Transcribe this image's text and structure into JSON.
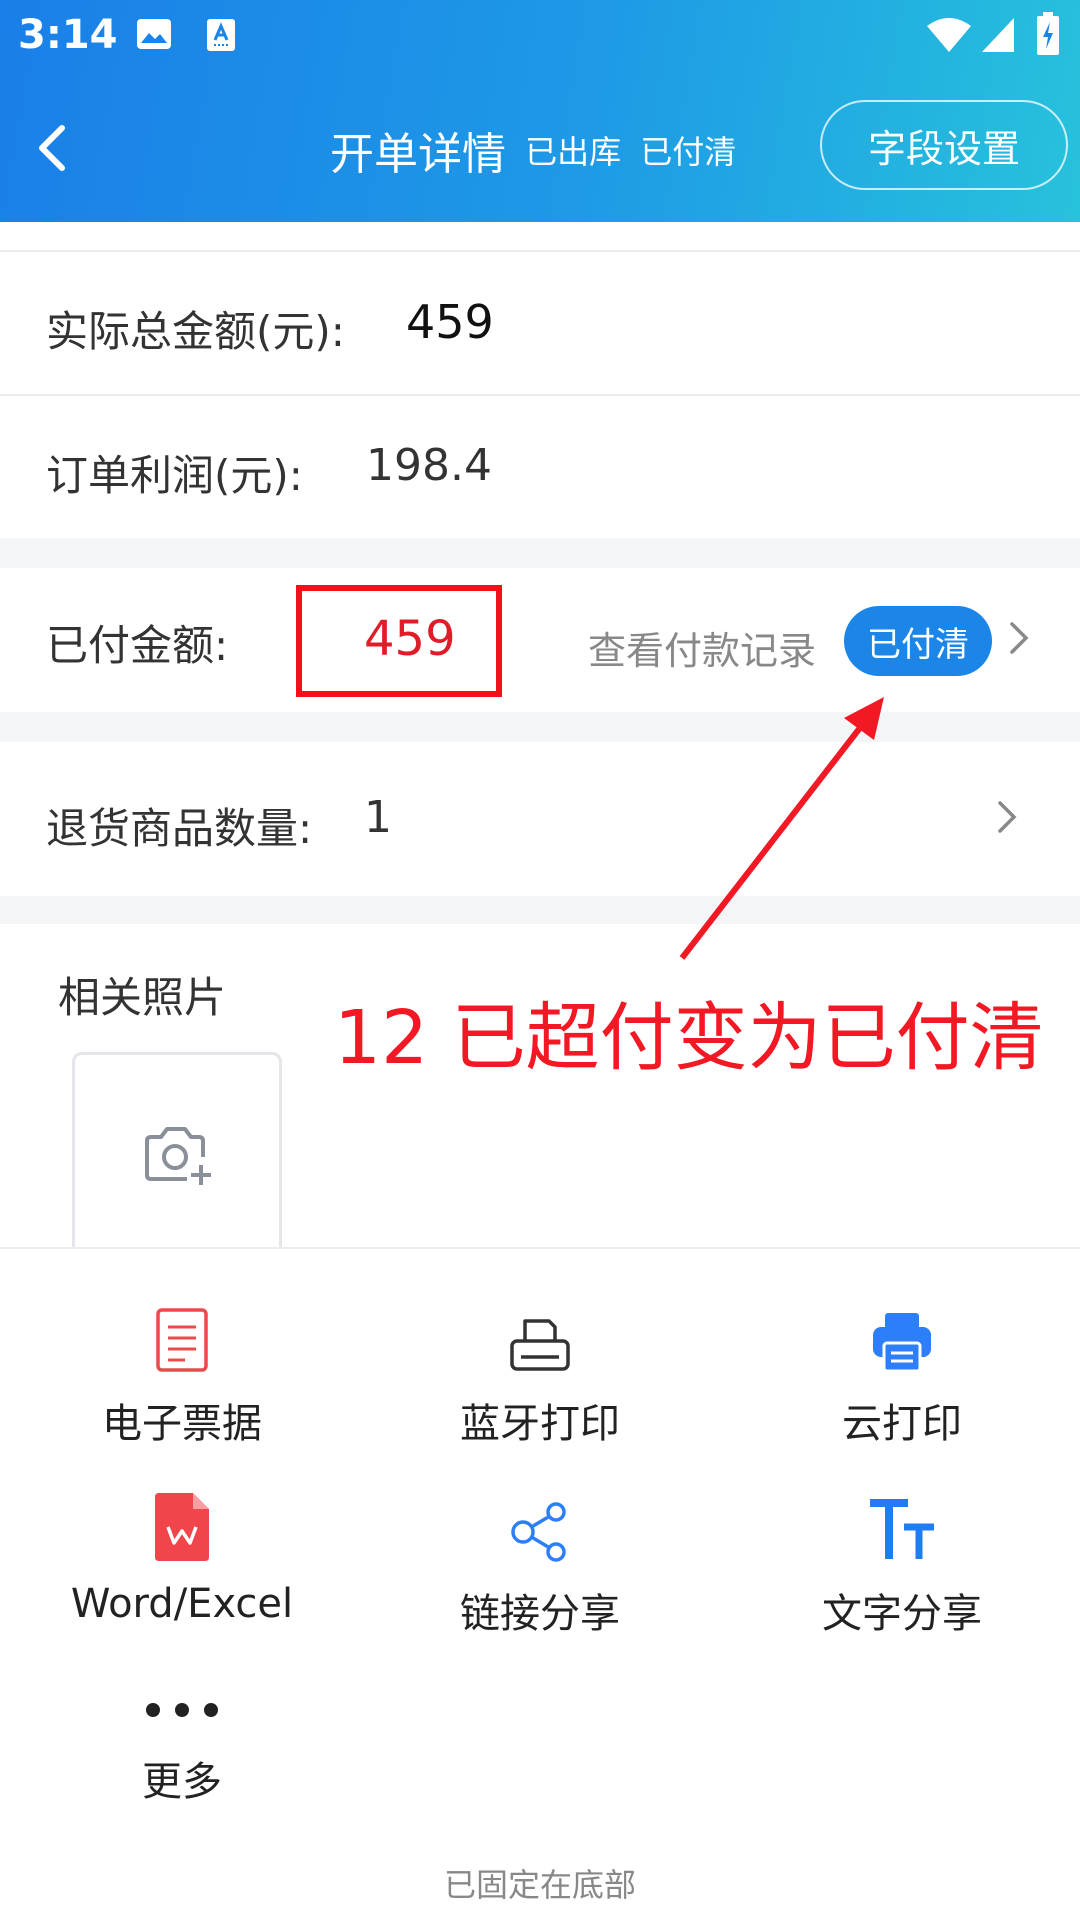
{
  "status_bar": {
    "time": "3:14"
  },
  "header": {
    "title": "开单详情",
    "status_out": "已出库",
    "status_paid": "已付清",
    "field_settings": "字段设置"
  },
  "rows": {
    "total_label": "实际总金额(元):",
    "total_value": "459",
    "profit_label": "订单利润(元):",
    "profit_value": "198.4",
    "paid_label": "已付金额:",
    "paid_value": "459",
    "view_record": "查看付款记录",
    "paid_badge": "已付清",
    "return_label": "退货商品数量:",
    "return_value": "1"
  },
  "annotation": "12 已超付变为已付清",
  "photos": {
    "title": "相关照片"
  },
  "actions": [
    {
      "label": "电子票据",
      "icon": "receipt-icon"
    },
    {
      "label": "蓝牙打印",
      "icon": "printer-icon"
    },
    {
      "label": "云打印",
      "icon": "cloud-print-icon"
    },
    {
      "label": "Word/Excel",
      "icon": "wps-icon"
    },
    {
      "label": "链接分享",
      "icon": "share-icon"
    },
    {
      "label": "文字分享",
      "icon": "text-icon"
    },
    {
      "label": "更多",
      "icon": "more-icon"
    }
  ],
  "footer": "已固定在底部",
  "colors": {
    "accent": "#1b86e8",
    "alert": "#f21824"
  }
}
